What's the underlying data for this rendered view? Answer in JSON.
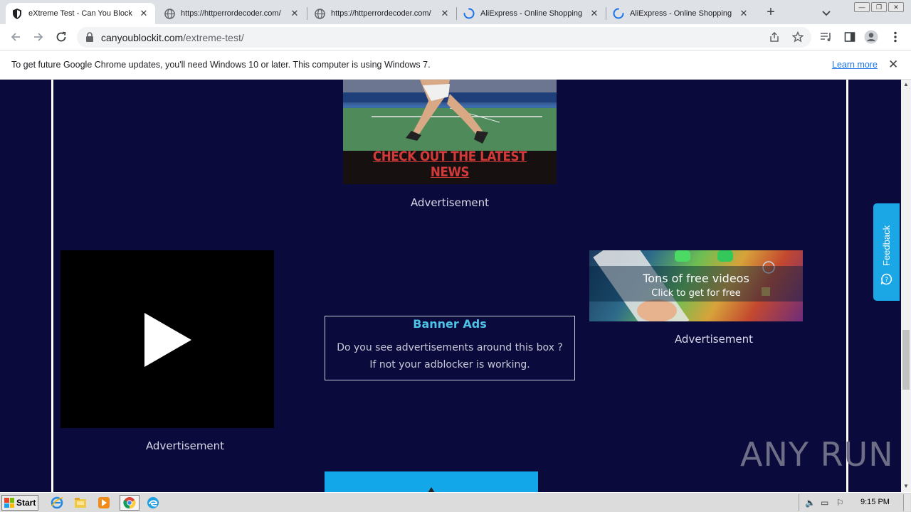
{
  "tabs": [
    {
      "title": "eXtreme Test - Can You Block It",
      "favicon": "shield-icon",
      "active": true
    },
    {
      "title": "https://httperrordecoder.com/",
      "favicon": "globe-icon",
      "active": false
    },
    {
      "title": "https://httperrordecoder.com/",
      "favicon": "globe-icon",
      "active": false
    },
    {
      "title": "AliExpress - Online Shopping for",
      "favicon": "loading-spinner-icon",
      "active": false
    },
    {
      "title": "AliExpress - Online Shopping for",
      "favicon": "loading-spinner-icon",
      "active": false
    }
  ],
  "omnibox": {
    "domain": "canyoublockit.com",
    "path": "/extreme-test/"
  },
  "infobar": {
    "message": "To get future Google Chrome updates, you'll need Windows 10 or later. This computer is using Windows 7.",
    "link": "Learn more"
  },
  "page": {
    "tennis_ad": {
      "cta": "CHECK OUT THE LATEST NEWS"
    },
    "ad_label": "Advertisement",
    "banner": {
      "title": "Banner Ads",
      "line1": "Do you see advertisements around this box ?",
      "line2": "If not your adblocker is working."
    },
    "videos_ad": {
      "headline": "Tons of free videos",
      "sub": "Click to get for free"
    },
    "feedback": "Feedback",
    "watermark": "ANY RUN"
  },
  "taskbar": {
    "start": "Start",
    "clock": "9:15 PM"
  },
  "colors": {
    "page_bg": "#0a0a3c",
    "banner_title": "#4cc3e6",
    "cta_red": "#d23a3a",
    "feedback_blue": "#1ba7e6"
  }
}
